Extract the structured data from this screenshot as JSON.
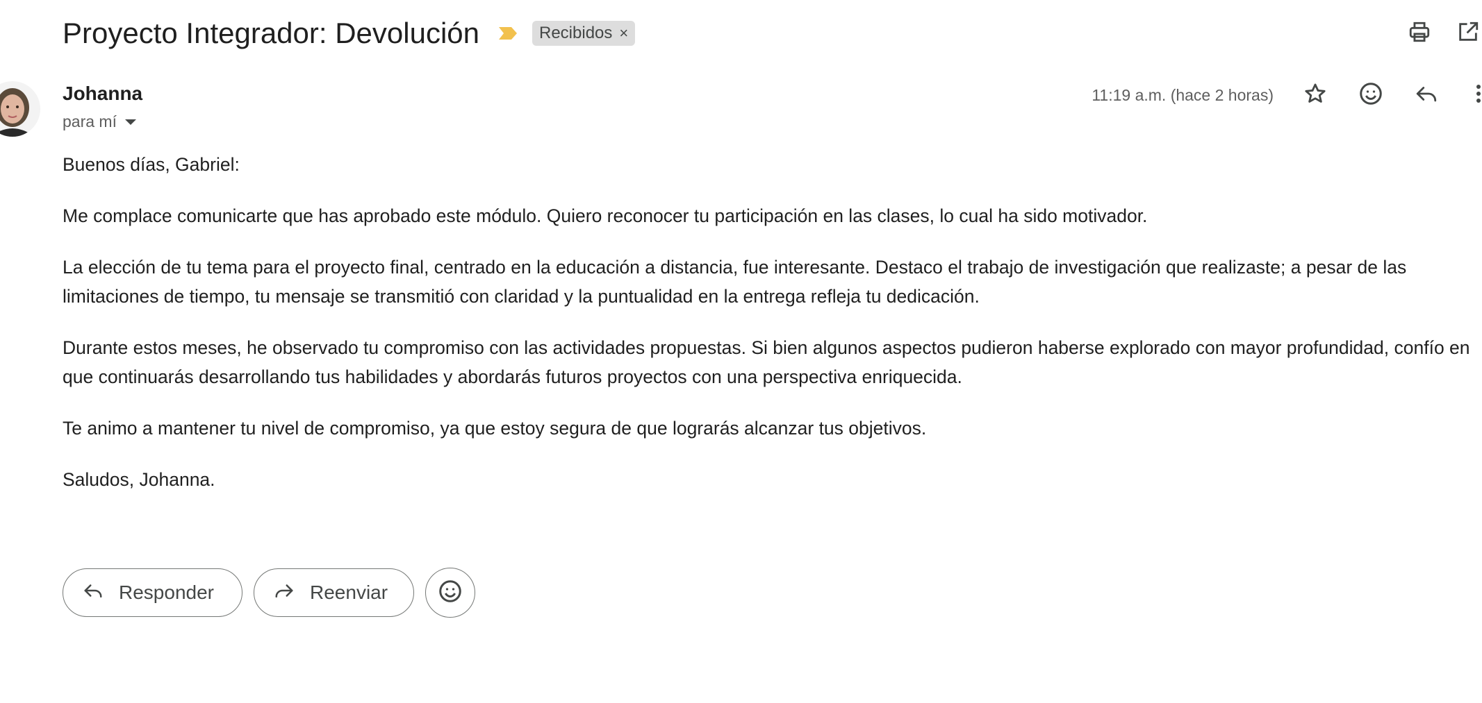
{
  "header": {
    "subject": "Proyecto Integrador: Devolución",
    "label": "Recibidos",
    "label_remove": "×",
    "importance_color": "#f2c14e"
  },
  "toolbar": {
    "print_icon": "printer-icon",
    "open_new_window_icon": "open-in-new-icon"
  },
  "message": {
    "sender_name": "Johanna",
    "recipient": "para mí",
    "timestamp": "11:19 a.m. (hace 2 horas)",
    "actions": {
      "star_icon": "star-icon",
      "emoji_icon": "emoji-icon",
      "reply_icon": "reply-icon",
      "more_icon": "more-vert-icon"
    },
    "body": [
      "Buenos días, Gabriel:",
      "Me complace comunicarte que has aprobado este módulo. Quiero reconocer tu participación en las clases, lo cual ha sido motivador.",
      "La elección de tu tema para el proyecto final, centrado en la educación a distancia, fue interesante. Destaco el trabajo de investigación que realizaste; a pesar de las limitaciones de tiempo, tu mensaje se transmitió con claridad y la puntualidad en la entrega refleja tu dedicación.",
      "Durante estos meses, he observado tu compromiso con las actividades propuestas. Si bien algunos aspectos pudieron haberse explorado con mayor profundidad, confío en que continuarás desarrollando tus habilidades y abordarás futuros proyectos con una perspectiva enriquecida.",
      "Te animo a mantener tu nivel de compromiso, ya que estoy segura de que lograrás alcanzar tus objetivos.",
      "Saludos, Johanna."
    ]
  },
  "footer": {
    "reply_label": "Responder",
    "forward_label": "Reenviar"
  }
}
